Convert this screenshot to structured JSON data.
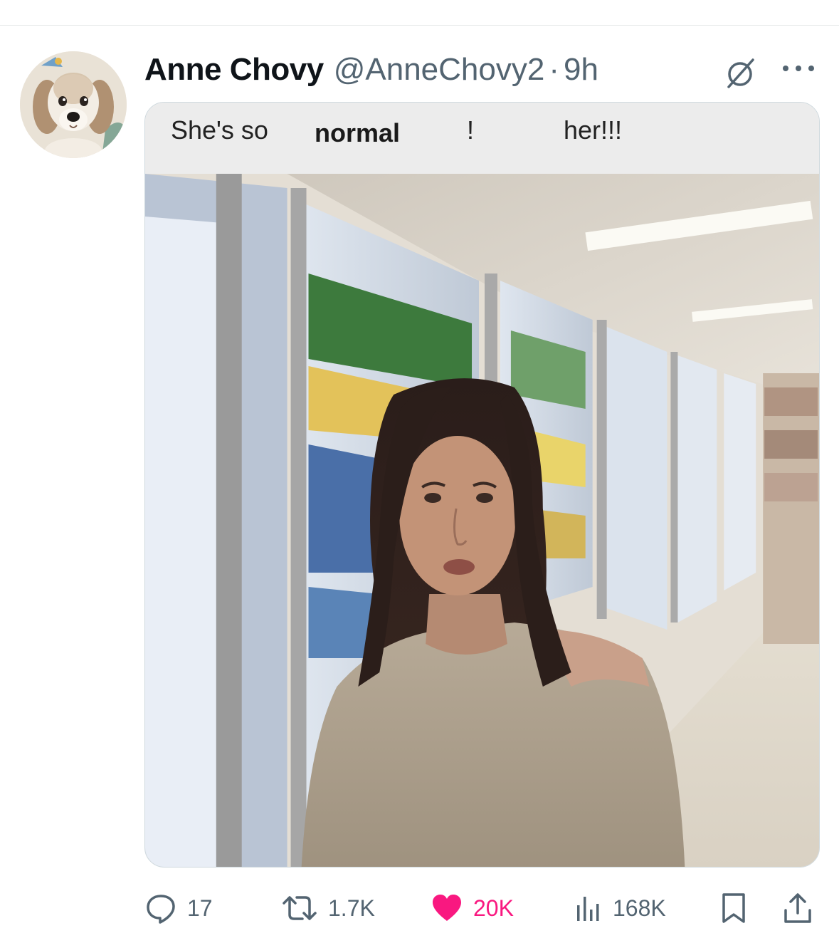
{
  "tweet": {
    "display_name": "Anne Chovy",
    "handle": "@AnneChovy2",
    "separator": "·",
    "time": "9h",
    "avatar_icon": "beagle-puppy-avatar"
  },
  "media": {
    "caption_parts": [
      "She's so",
      "normal",
      "!",
      "her!!!"
    ],
    "photo_subject": "woman-in-grocery-freezer-aisle"
  },
  "actions": {
    "replies": "17",
    "reposts": "1.7K",
    "likes": "20K",
    "views": "168K"
  },
  "colors": {
    "like_pink": "#f91880",
    "muted_gray": "#536471",
    "text_dark": "#0f1419"
  }
}
